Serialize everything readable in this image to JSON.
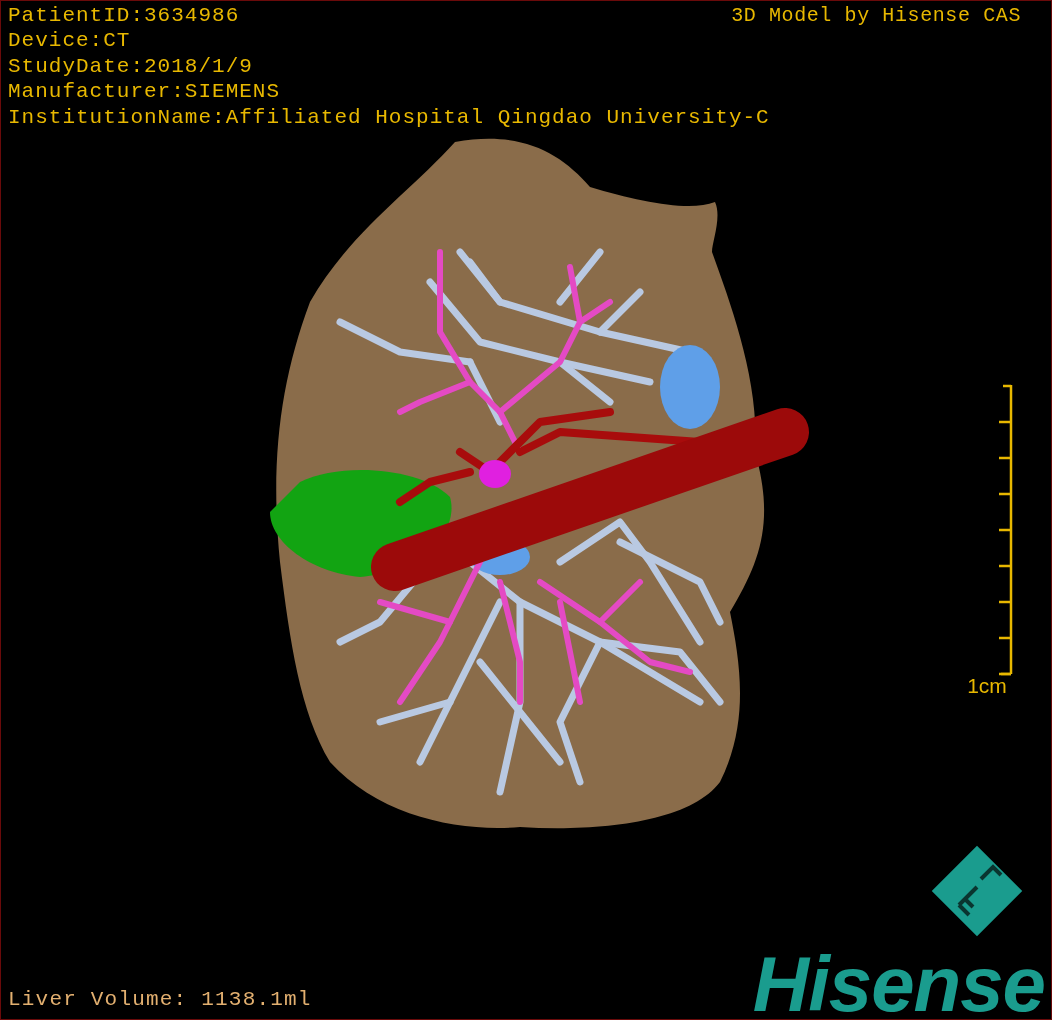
{
  "info_lines": [
    "PatientID:3634986",
    "Device:CT",
    "StudyDate:2018/1/9",
    "Manufacturer:SIEMENS",
    "InstitutionName:Affiliated Hospital Qingdao University-C"
  ],
  "title": "3D Model by Hisense CAS",
  "scale_bar": {
    "label": "1cm"
  },
  "measurement": "Liver Volume: 1138.1ml",
  "brand": {
    "name": "Hisense"
  }
}
